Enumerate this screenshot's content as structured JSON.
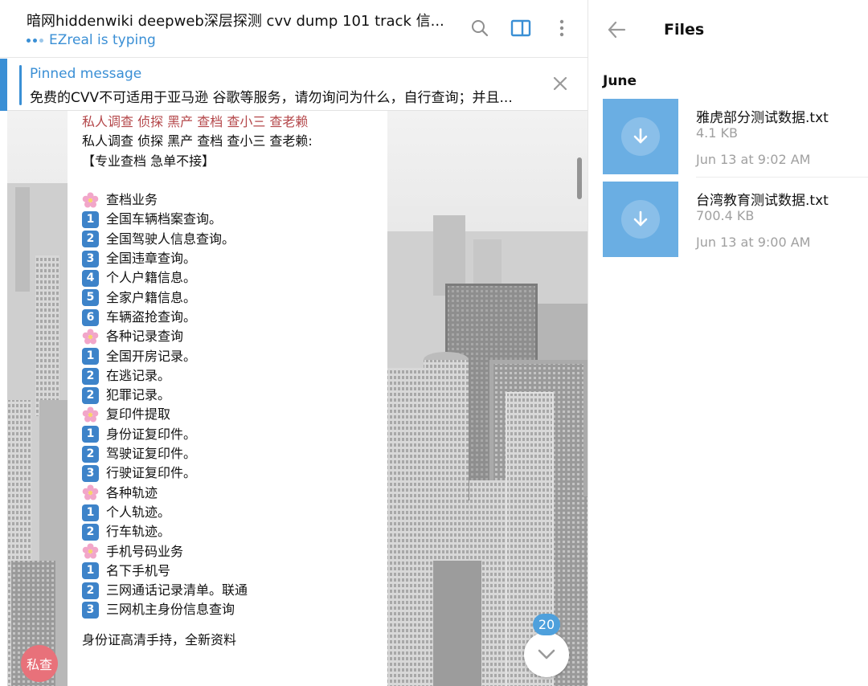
{
  "chat": {
    "title": "暗网hiddenwiki deepweb深层探测 cvv dump 101 track 信...",
    "typing_status": "EZreal is typing",
    "pinned_label": "Pinned message",
    "pinned_text": "免费的CVV不可适用于亚马逊 谷歌等服务，请勿询问为什么，自行查询；并且...",
    "unread_count": "20",
    "avatar_text": "私查",
    "message": {
      "lines": [
        {
          "type": "text",
          "text": "私人调查 侦探 黑产 查档 查小三 查老赖",
          "color": "red"
        },
        {
          "type": "text",
          "text": "私人调查 侦探 黑产 查档 查小三 查老赖:"
        },
        {
          "type": "text",
          "text": "【专业查档 急单不接】"
        },
        {
          "type": "blank"
        },
        {
          "type": "flower",
          "text": "查档业务"
        },
        {
          "type": "num",
          "key": "1",
          "text": "全国车辆档案查询。"
        },
        {
          "type": "num",
          "key": "2",
          "text": "全国驾驶人信息查询。"
        },
        {
          "type": "num",
          "key": "3",
          "text": "全国违章查询。"
        },
        {
          "type": "num",
          "key": "4",
          "text": "个人户籍信息。"
        },
        {
          "type": "num",
          "key": "5",
          "text": "全家户籍信息。"
        },
        {
          "type": "num",
          "key": "6",
          "text": "车辆盗抢查询。"
        },
        {
          "type": "flower",
          "text": "各种记录查询"
        },
        {
          "type": "num",
          "key": "1",
          "text": "全国开房记录。"
        },
        {
          "type": "num",
          "key": "2",
          "text": "在逃记录。"
        },
        {
          "type": "num",
          "key": "2",
          "text": "犯罪记录。"
        },
        {
          "type": "flower",
          "text": "复印件提取"
        },
        {
          "type": "num",
          "key": "1",
          "text": "身份证复印件。"
        },
        {
          "type": "num",
          "key": "2",
          "text": "驾驶证复印件。"
        },
        {
          "type": "num",
          "key": "3",
          "text": "行驶证复印件。"
        },
        {
          "type": "flower",
          "text": "各种轨迹"
        },
        {
          "type": "num",
          "key": "1",
          "text": "个人轨迹。"
        },
        {
          "type": "num",
          "key": "2",
          "text": "行车轨迹。"
        },
        {
          "type": "flower",
          "text": "手机号码业务"
        },
        {
          "type": "num",
          "key": "1",
          "text": "名下手机号"
        },
        {
          "type": "num",
          "key": "2",
          "text": "三网通话记录清单。联通"
        },
        {
          "type": "num",
          "key": "3",
          "text": "三网机主身份信息查询"
        },
        {
          "type": "gap"
        },
        {
          "type": "text",
          "text": "身份证高清手持，全新资料"
        }
      ]
    }
  },
  "files_panel": {
    "title": "Files",
    "month": "June",
    "files": [
      {
        "name": "雅虎部分测试数据.txt",
        "size": "4.1 KB",
        "date": "Jun 13 at 9:02 AM"
      },
      {
        "name": "台湾教育测试数据.txt",
        "size": "700.4 KB",
        "date": "Jun 13 at 9:00 AM"
      }
    ]
  },
  "icons": {
    "search": "search-icon",
    "sidebar": "sidebar-toggle-icon",
    "more": "more-vertical-icon",
    "close": "close-icon",
    "back": "arrow-left-icon",
    "download": "download-icon",
    "chevron": "chevron-down-icon",
    "flower": "cherry-blossom-icon"
  },
  "colors": {
    "accent": "#3a8fd5",
    "file_thumb": "#6aaee3",
    "key_cap": "#3d83c9",
    "red_text": "#b4474a",
    "avatar": "#e8717a"
  }
}
